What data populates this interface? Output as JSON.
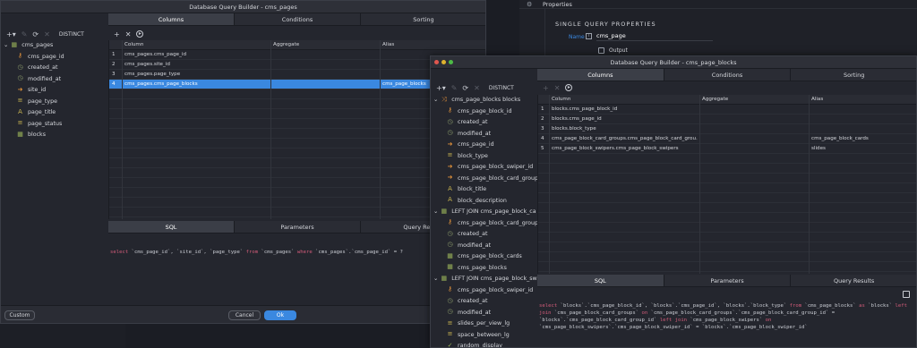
{
  "props": {
    "title": "Properties",
    "section": "SINGLE QUERY PROPERTIES",
    "name_label": "Name",
    "name_value": "cms_page",
    "output_label": "Output"
  },
  "win1": {
    "title": "Database Query Builder - cms_pages",
    "tabs": [
      "Columns",
      "Conditions",
      "Sorting"
    ],
    "distinct": "DISTINCT",
    "tree": [
      {
        "icon": "table",
        "label": "cms_pages",
        "indent": 0
      },
      {
        "icon": "key",
        "label": "cms_page_id",
        "indent": 1
      },
      {
        "icon": "clock",
        "label": "created_at",
        "indent": 1
      },
      {
        "icon": "clock",
        "label": "modified_at",
        "indent": 1
      },
      {
        "icon": "arrow",
        "label": "site_id",
        "indent": 1
      },
      {
        "icon": "equals",
        "label": "page_type",
        "indent": 1
      },
      {
        "icon": "text",
        "label": "page_title",
        "indent": 1
      },
      {
        "icon": "equals",
        "label": "page_status",
        "indent": 1
      },
      {
        "icon": "table",
        "label": "blocks",
        "indent": 1
      }
    ],
    "grid": {
      "headers": [
        "Column",
        "Aggregate",
        "Alias"
      ],
      "rows": [
        [
          "1",
          "cms_pages.cms_page_id",
          "",
          ""
        ],
        [
          "2",
          "cms_pages.site_id",
          "",
          ""
        ],
        [
          "3",
          "cms_pages.page_type",
          "",
          ""
        ],
        [
          "4",
          "cms_pages.cms_page_blocks",
          "",
          "cms_page_blocks"
        ]
      ]
    },
    "bottom_tabs": [
      "SQL",
      "Parameters",
      "Query Results"
    ],
    "sql": "select `cms_page_id`, `site_id`, `page_type` from `cms_pages` where `cms_pages`.`cms_page_id` = ?",
    "custom": "Custom",
    "cancel": "Cancel",
    "ok": "Ok"
  },
  "win2": {
    "title": "Database Query Builder - cms_page_blocks",
    "tabs": [
      "Columns",
      "Conditions",
      "Sorting"
    ],
    "distinct": "DISTINCT",
    "tree": [
      {
        "icon": "join",
        "label": "cms_page_blocks blocks",
        "indent": 0
      },
      {
        "icon": "key",
        "label": "cms_page_block_id",
        "indent": 1
      },
      {
        "icon": "clock",
        "label": "created_at",
        "indent": 1
      },
      {
        "icon": "clock",
        "label": "modified_at",
        "indent": 1
      },
      {
        "icon": "arrow",
        "label": "cms_page_id",
        "indent": 1
      },
      {
        "icon": "equals",
        "label": "block_type",
        "indent": 1
      },
      {
        "icon": "arrow",
        "label": "cms_page_block_swiper_id",
        "indent": 1
      },
      {
        "icon": "arrow",
        "label": "cms_page_block_card_group",
        "indent": 1
      },
      {
        "icon": "text",
        "label": "block_title",
        "indent": 1
      },
      {
        "icon": "text",
        "label": "block_description",
        "indent": 1
      },
      {
        "icon": "table",
        "label": "LEFT JOIN cms_page_block_ca",
        "indent": 0
      },
      {
        "icon": "key",
        "label": "cms_page_block_card_group",
        "indent": 1
      },
      {
        "icon": "clock",
        "label": "created_at",
        "indent": 1
      },
      {
        "icon": "clock",
        "label": "modified_at",
        "indent": 1
      },
      {
        "icon": "table",
        "label": "cms_page_block_cards",
        "indent": 1
      },
      {
        "icon": "table",
        "label": "cms_page_blocks",
        "indent": 1
      },
      {
        "icon": "table",
        "label": "LEFT JOIN cms_page_block_sw",
        "indent": 0
      },
      {
        "icon": "key",
        "label": "cms_page_block_swiper_id",
        "indent": 1
      },
      {
        "icon": "clock",
        "label": "created_at",
        "indent": 1
      },
      {
        "icon": "clock",
        "label": "modified_at",
        "indent": 1
      },
      {
        "icon": "equals",
        "label": "slides_per_view_lg",
        "indent": 1
      },
      {
        "icon": "equals",
        "label": "space_between_lg",
        "indent": 1
      },
      {
        "icon": "check",
        "label": "random_display",
        "indent": 1
      }
    ],
    "grid": {
      "headers": [
        "Column",
        "Aggregate",
        "Alias"
      ],
      "rows": [
        [
          "1",
          "blocks.cms_page_block_id",
          "",
          ""
        ],
        [
          "2",
          "blocks.cms_page_id",
          "",
          ""
        ],
        [
          "3",
          "blocks.block_type",
          "",
          ""
        ],
        [
          "4",
          "cms_page_block_card_groups.cms_page_block_card_grou...",
          "",
          "cms_page_block_cards"
        ],
        [
          "5",
          "cms_page_block_swipers.cms_page_block_swipers",
          "",
          "slides"
        ]
      ]
    },
    "bottom_tabs": [
      "SQL",
      "Parameters",
      "Query Results"
    ],
    "sql": "select `blocks`.`cms_page_block_id`, `blocks`.`cms_page_id`, `blocks`.`block_type` from `cms_page_blocks` as `blocks` left join `cms_page_block_card_groups` on `cms_page_block_card_groups`.`cms_page_block_card_group_id` = `blocks`.`cms_page_block_card_group_id` left join `cms_page_block_swipers` on `cms_page_block_swipers`.`cms_page_block_swiper_id` = `blocks`.`cms_page_block_swiper_id`"
  }
}
